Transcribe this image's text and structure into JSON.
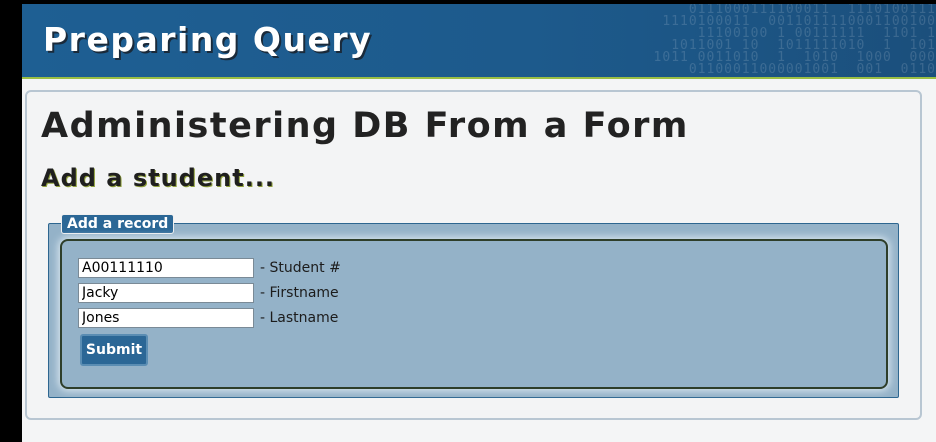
{
  "header": {
    "title": "Preparing Query",
    "binary_pattern": "0111000111100011  1110100111\n1110100011  0011011110001100100\n11100100 1 00111111  1101 1\n1011001 10  1011111010  1  101\n1011 0011010  1  1010  1000  000\n01100011000001001  001  0110"
  },
  "main": {
    "heading": "Administering DB From a Form",
    "subheading": "Add a student..."
  },
  "form": {
    "legend": "Add a record",
    "fields": [
      {
        "value": "A00111110",
        "label": "- Student #"
      },
      {
        "value": "Jacky",
        "label": "- Firstname"
      },
      {
        "value": "Jones",
        "label": "- Lastname"
      }
    ],
    "submit_label": "Submit"
  },
  "colors": {
    "banner_blue": "#1e5f93",
    "accent_green": "#9bbf44",
    "form_bg": "#94b2c8",
    "button_blue": "#2b6796"
  }
}
